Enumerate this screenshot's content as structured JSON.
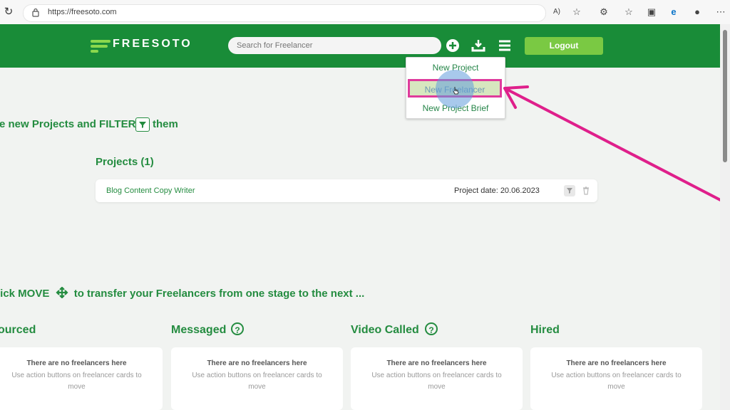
{
  "browser": {
    "url": "https://freesoto.com"
  },
  "app": {
    "brand": "FREESOTO",
    "search_placeholder": "Search for Freelancer",
    "logout_label": "Logout",
    "accent_color": "#198c38",
    "button_color": "#7ac943"
  },
  "dropdown": {
    "items": [
      {
        "label": "New Project"
      },
      {
        "label": "New Freelancer"
      },
      {
        "label": "New Project Brief"
      }
    ]
  },
  "projects": {
    "intro_text": "e new Projects and FILTER",
    "intro_suffix": "them",
    "title": "Projects (1)",
    "items": [
      {
        "name": "Blog Content Copy Writer",
        "date": "Project date: 20.06.2023"
      }
    ]
  },
  "stages": {
    "intro_text": "lick MOVE",
    "intro_suffix": "to transfer your Freelancers from one stage to the next ...",
    "columns": [
      {
        "title": "ourced",
        "empty": "There are no freelancers here",
        "hint": "Use action buttons on freelancer cards to move"
      },
      {
        "title": "Messaged",
        "empty": "There are no freelancers here",
        "hint": "Use action buttons on freelancer cards to move"
      },
      {
        "title": "Video Called",
        "empty": "There are no freelancers here",
        "hint": "Use action buttons on freelancer cards to move"
      },
      {
        "title": "Hired",
        "empty": "There are no freelancers here",
        "hint": "Use action buttons on freelancer cards to move"
      }
    ]
  }
}
